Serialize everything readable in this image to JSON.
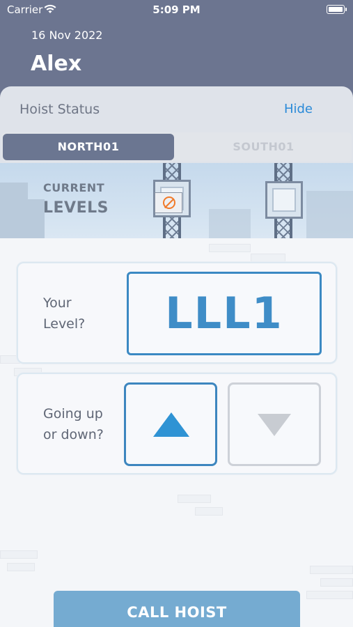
{
  "status_bar": {
    "carrier": "Carrier",
    "time": "5:09 PM",
    "wifi_icon": "wifi-icon",
    "battery_icon": "battery-icon"
  },
  "header": {
    "date": "16 Nov 2022",
    "user_name": "Alex"
  },
  "hoist_status": {
    "title": "Hoist Status",
    "hide_label": "Hide",
    "tabs": [
      {
        "label": "NORTH01",
        "selected": true
      },
      {
        "label": "SOUTH01",
        "selected": false
      }
    ],
    "current_label": "CURRENT",
    "levels_label": "LEVELS",
    "unavailable_icon": "no-entry-icon"
  },
  "form": {
    "level_label_line1": "Your",
    "level_label_line2": "Level?",
    "level_value": "LLL1",
    "direction_label_line1": "Going up",
    "direction_label_line2": "or down?",
    "direction_selected": "up",
    "up_icon": "arrow-up-icon",
    "down_icon": "arrow-down-icon",
    "call_button": "CALL HOIST"
  },
  "colors": {
    "accent": "#3b89c3",
    "header_bg": "#6c7590",
    "call_button": "#75abd1",
    "warning": "#f07a2a"
  }
}
